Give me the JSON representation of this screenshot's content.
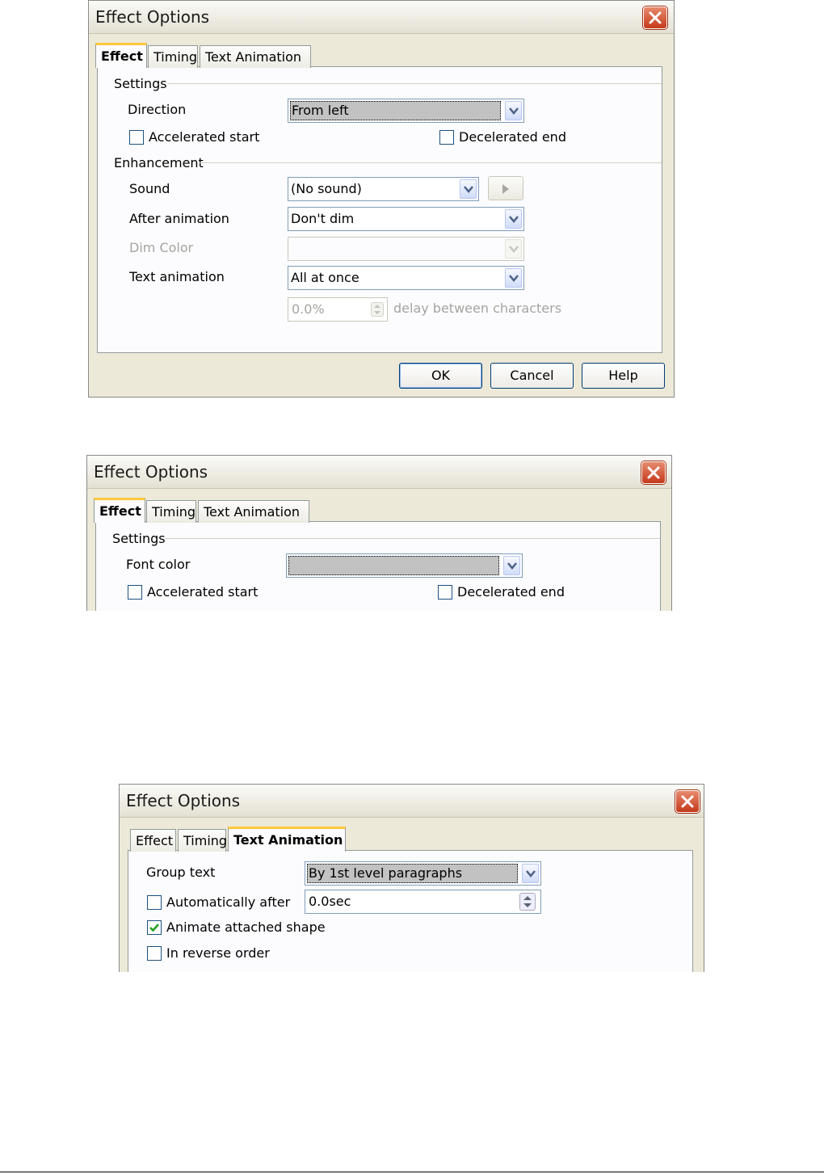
{
  "dialog1": {
    "title": "Effect Options",
    "tabs": [
      "Effect",
      "Timing",
      "Text Animation"
    ],
    "settings_label": "Settings",
    "direction_label": "Direction",
    "direction_value": "From left",
    "accelerated_start": "Accelerated start",
    "accelerated_checked": false,
    "decelerated_end": "Decelerated end",
    "decelerated_checked": false,
    "enhancement_label": "Enhancement",
    "sound_label": "Sound",
    "sound_value": "(No sound)",
    "after_animation_label": "After animation",
    "after_animation_value": "Don't dim",
    "dim_color_label": "Dim Color",
    "dim_color_value": "",
    "text_animation_label": "Text animation",
    "text_animation_value": "All at once",
    "delay_value": "0.0%",
    "delay_label": "delay between characters",
    "ok": "OK",
    "cancel": "Cancel",
    "help": "Help"
  },
  "dialog2": {
    "title": "Effect Options",
    "tabs": [
      "Effect",
      "Timing",
      "Text Animation"
    ],
    "settings_label": "Settings",
    "font_color_label": "Font color",
    "font_color_value": "",
    "accelerated_start": "Accelerated start",
    "accelerated_checked": false,
    "decelerated_end": "Decelerated end",
    "decelerated_checked": false
  },
  "dialog3": {
    "title": "Effect Options",
    "tabs": [
      "Effect",
      "Timing",
      "Text Animation"
    ],
    "group_text_label": "Group text",
    "group_text_value": "By 1st level paragraphs",
    "automatically_after": "Automatically after",
    "automatically_checked": false,
    "automatically_value": "0.0sec",
    "animate_attached_shape": "Animate attached shape",
    "animate_checked": true,
    "in_reverse_order": "In reverse order",
    "reverse_checked": false
  },
  "icons": {
    "close": "close-icon",
    "dropdown": "chevron-down-icon",
    "play": "play-icon",
    "spin": "spin-arrows-icon",
    "check": "checkmark-icon"
  },
  "colors": {
    "close_button": "#c4391a",
    "active_tab_accent": "#ffc83c",
    "dialog_background": "#ece9d8",
    "checkmark": "#21a121"
  }
}
